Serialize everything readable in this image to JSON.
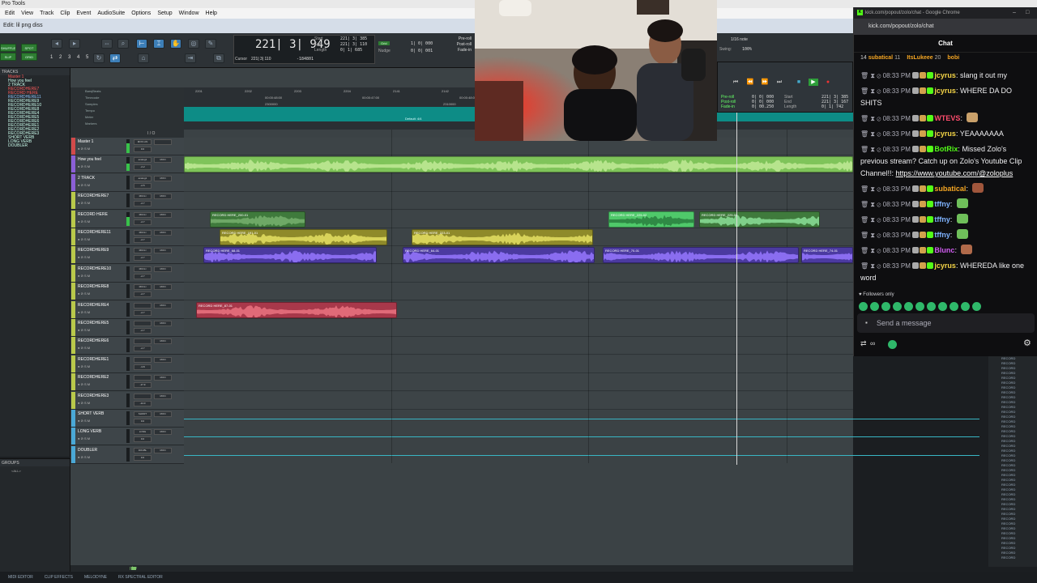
{
  "app": {
    "title": "Pro Tools",
    "menus": [
      "Edit",
      "View",
      "Track",
      "Clip",
      "Event",
      "AudioSuite",
      "Options",
      "Setup",
      "Window",
      "Help"
    ],
    "edit_window_title": "Edit: lil png diss"
  },
  "toolbar": {
    "shuffle": "SHUFFLE",
    "spot": "SPOT",
    "slip": "SLIP",
    "grid": "GRID",
    "zoom_presets": "1 2 3 4 5",
    "main_counter": "221| 3| 949",
    "start_label": "Start",
    "end_label": "End",
    "length_label": "Length",
    "start_value": "221| 3| 385",
    "end_value": "221| 3| 110",
    "length_value": "0| 1| 685",
    "cursor_label": "Cursor",
    "cursor_value": "221| 3| 110",
    "cursor_extra": "-184801",
    "grid_label": "Grid",
    "nudge_label": "Nudge",
    "grid_value": "1| 0| 000",
    "nudge_value": "0| 0| 001",
    "preroll": "Pre-roll",
    "postroll": "Post-roll",
    "fadein": "Fade-in"
  },
  "transport": {
    "note_value": "1/16 note",
    "swing_label": "Swing:",
    "swing_value": "100%",
    "pre_roll": "Pre-roll",
    "post_roll": "Post-roll",
    "fade_in": "Fade-in",
    "pre_val": "0| 0| 000",
    "post_val": "0| 0| 000",
    "fade_val": "0| 00.250",
    "start_lbl": "Start",
    "end_lbl": "End",
    "length_lbl": "Length",
    "start_val": "221| 3| 385",
    "end_val": "221| 3| 167",
    "length_val": "0| 1| 742"
  },
  "tracks_panel": {
    "title": "TRACKS",
    "items": [
      {
        "name": "Master 1",
        "color": "red"
      },
      {
        "name": "How you feel",
        "color": "normal"
      },
      {
        "name": "2 TRACK",
        "color": "normal"
      },
      {
        "name": "RECORDHERE7",
        "color": "red"
      },
      {
        "name": "RECORD HERE",
        "color": "red"
      },
      {
        "name": "RECORDHERE11",
        "color": "blue"
      },
      {
        "name": "RECORDHERE9",
        "color": "normal"
      },
      {
        "name": "RECORDHERE10",
        "color": "normal"
      },
      {
        "name": "RECORDHERE8",
        "color": "normal"
      },
      {
        "name": "RECORDHERE4",
        "color": "normal"
      },
      {
        "name": "RECORDHERE5",
        "color": "normal"
      },
      {
        "name": "RECORDHERE6",
        "color": "normal"
      },
      {
        "name": "RECORDHERE1",
        "color": "normal"
      },
      {
        "name": "RECORDHERE2",
        "color": "normal"
      },
      {
        "name": "RECORDHERE3",
        "color": "normal"
      },
      {
        "name": "SHORT VERB",
        "color": "normal"
      },
      {
        "name": "LONG VERB",
        "color": "normal"
      },
      {
        "name": "DOUBLER",
        "color": "normal"
      }
    ]
  },
  "groups_panel": {
    "title": "GROUPS",
    "items": [
      "<ALL>"
    ]
  },
  "rulers": {
    "names": [
      "Bars|Beats",
      "Timecode",
      "Samples",
      "Tempo",
      "Meter",
      "Markers"
    ],
    "bar_labels": [
      "2201",
      "2202",
      "2203",
      "2204",
      "2141",
      "2142"
    ],
    "timecode_labels": [
      "00:00:48:00",
      "00:00:47:00",
      "00:00:48:00"
    ],
    "sample_labels": [
      "2300000",
      "2310000"
    ],
    "default_tag": "Default: 4/4",
    "io_header": "I / O"
  },
  "tracks": [
    {
      "name": "Master 1",
      "io": "MON LIN",
      "vol": "0.0",
      "mon": "",
      "color": "#d24a4a",
      "meter": 70,
      "kind": "master"
    },
    {
      "name": "How you feel",
      "io": "analog1",
      "vol": "-2.2",
      "mon": "MON",
      "color": "#8b5fd6",
      "meter": 55,
      "kind": "audio"
    },
    {
      "name": "2 TRACK",
      "io": "analog1",
      "vol": "-2.5",
      "mon": "MON",
      "color": "#8b5fd6",
      "meter": 0,
      "kind": "audio"
    },
    {
      "name": "RECORDHERE7",
      "io": "MIC/LI",
      "vol": "-2.7",
      "mon": "MON",
      "color": "#b9c94a",
      "meter": 0,
      "kind": "audio"
    },
    {
      "name": "RECORD HERE",
      "io": "MIC/LI",
      "vol": "-2.7",
      "mon": "MON",
      "color": "#b9c94a",
      "meter": 60,
      "kind": "audio"
    },
    {
      "name": "RECORDHERE11",
      "io": "MIC/LI",
      "vol": "-2.7",
      "mon": "MON",
      "color": "#b9c94a",
      "meter": 0,
      "kind": "audio"
    },
    {
      "name": "RECORDHERE9",
      "io": "MIC/LI",
      "vol": "-2.7",
      "mon": "MON",
      "color": "#b9c94a",
      "meter": 0,
      "kind": "audio"
    },
    {
      "name": "RECORDHERE10",
      "io": "MIC/LI",
      "vol": "-2.7",
      "mon": "MON",
      "color": "#b9c94a",
      "meter": 0,
      "kind": "audio"
    },
    {
      "name": "RECORDHERE8",
      "io": "MIC/LI",
      "vol": "-2.7",
      "mon": "MON",
      "color": "#b9c94a",
      "meter": 0,
      "kind": "audio"
    },
    {
      "name": "RECORDHERE4",
      "io": "",
      "vol": "-2.7",
      "mon": "MON",
      "color": "#b9c94a",
      "meter": 0,
      "kind": "audio"
    },
    {
      "name": "RECORDHERE5",
      "io": "",
      "vol": "-2.7",
      "mon": "MON",
      "color": "#b9c94a",
      "meter": 0,
      "kind": "audio"
    },
    {
      "name": "RECORDHERE6",
      "io": "",
      "vol": "-2.7",
      "mon": "MON",
      "color": "#b9c94a",
      "meter": 0,
      "kind": "audio"
    },
    {
      "name": "RECORDHERE1",
      "io": "",
      "vol": "-3.8",
      "mon": "MON",
      "color": "#b9c94a",
      "meter": 0,
      "kind": "audio"
    },
    {
      "name": "RECORDHERE2",
      "io": "",
      "vol": "-17.9",
      "mon": "MON",
      "color": "#b9c94a",
      "meter": 0,
      "kind": "audio"
    },
    {
      "name": "RECORDHERE3",
      "io": "",
      "vol": "-14.0",
      "mon": "MON",
      "color": "#b9c94a",
      "meter": 0,
      "kind": "audio"
    },
    {
      "name": "SHORT VERB",
      "io": "SHORT",
      "vol": "0.0",
      "mon": "MON",
      "color": "#4aa8d6",
      "meter": 0,
      "kind": "aux"
    },
    {
      "name": "LONG VERB",
      "io": "LONG",
      "vol": "0.0",
      "mon": "MON",
      "color": "#4aa8d6",
      "meter": 0,
      "kind": "aux"
    },
    {
      "name": "DOUBLER",
      "io": "DOUBL",
      "vol": "0.0",
      "mon": "MON",
      "color": "#4aa8d6",
      "meter": 0,
      "kind": "aux"
    }
  ],
  "clips": [
    {
      "track": 1,
      "name": "",
      "start": 0,
      "end": 826,
      "color": "#7fc45a",
      "wave": "#b7e48d"
    },
    {
      "track": 4,
      "name": "RECORD HERE_200-01",
      "start": 32,
      "end": 150,
      "color": "#3f7a3c",
      "wave": "#6ea866"
    },
    {
      "track": 4,
      "name": "RECORD HERE_225-02",
      "start": 524,
      "end": 630,
      "color": "#4fc96a",
      "wave": "#2f8a45"
    },
    {
      "track": 4,
      "name": "RECORD HERE_225-03",
      "start": 636,
      "end": 785,
      "color": "#3f7a3c",
      "wave": "#7fd08a"
    },
    {
      "track": 5,
      "name": "RECORD HERE_191-01",
      "start": 44,
      "end": 251,
      "color": "#8f8a2a",
      "wave": "#d8d35a"
    },
    {
      "track": 5,
      "name": "RECORD HERE_223-01",
      "start": 281,
      "end": 505,
      "color": "#8f8a2a",
      "wave": "#d8d35a"
    },
    {
      "track": 6,
      "name": "RECORD HERE_68-01",
      "start": 24,
      "end": 238,
      "color": "#4b3aa0",
      "wave": "#8a6df0"
    },
    {
      "track": 6,
      "name": "RECORD HERE_64-01",
      "start": 270,
      "end": 507,
      "color": "#4b3aa0",
      "wave": "#8a6df0"
    },
    {
      "track": 6,
      "name": "RECORD HERE_70-01",
      "start": 517,
      "end": 759,
      "color": "#4b3aa0",
      "wave": "#8a6df0"
    },
    {
      "track": 6,
      "name": "RECORD HERE_74-01",
      "start": 762,
      "end": 826,
      "color": "#4b3aa0",
      "wave": "#8a6df0"
    },
    {
      "track": 9,
      "name": "RECORD HERE_87-01",
      "start": 15,
      "end": 263,
      "color": "#a8384a",
      "wave": "#e06a78"
    }
  ],
  "bottom_bar": {
    "tabs": [
      "MIDI EDITOR",
      "CLIP EFFECTS",
      "MELODYNE",
      "RX SPECTRAL EDITOR"
    ],
    "scroll_label": "play"
  },
  "right_list": {
    "items": [
      "RECORD",
      "RECORD",
      "RECORD",
      "RECORD",
      "RECORD",
      "RECORD",
      "RECORD",
      "RECORD",
      "RECORD",
      "RECORD",
      "RECORD",
      "RECORD",
      "RECORD",
      "RECORD",
      "RECORD",
      "RECORD",
      "RECORD",
      "RECORD",
      "RECORD",
      "RECORD",
      "RECORD",
      "RECORD",
      "RECORD",
      "RECORD",
      "RECORD",
      "RECORD",
      "RECORD",
      "RECORD",
      "RECORD",
      "RECORD",
      "RECORD",
      "RECORD",
      "RECORD",
      "RECORD",
      "RECORD",
      "RECORD",
      "RECORD",
      "RECORD",
      "RECORD",
      "RECORD",
      "RECORD",
      "RECORD"
    ]
  },
  "chat": {
    "window_title": "kick.com/popout/zolo/chat - Google Chrome",
    "url": "kick.com/popout/zolo/chat",
    "header": "Chat",
    "pinned": [
      {
        "rank": "14",
        "user": "subatical",
        "count": "11"
      },
      {
        "rank": "",
        "user": "ItsLukeee",
        "count": "20"
      },
      {
        "rank": "",
        "user": "bobi",
        "count": ""
      }
    ],
    "messages": [
      {
        "time": "08:33 PM",
        "user": "jcyrus",
        "color": "#f5d547",
        "text": "slang it out my",
        "emote": ""
      },
      {
        "time": "08:33 PM",
        "user": "jcyrus",
        "color": "#f5d547",
        "text": "WHERE DA DO SHITS",
        "emote": ""
      },
      {
        "time": "08:33 PM",
        "user": "WTEVS",
        "color": "#ff4d6d",
        "text": "",
        "emote": "#c9a06a"
      },
      {
        "time": "08:33 PM",
        "user": "jcyrus",
        "color": "#f5d547",
        "text": "YEAAAAAAA",
        "emote": ""
      },
      {
        "time": "08:33 PM",
        "user": "BotRix",
        "color": "#53fc18",
        "text": "Missed Zolo's previous stream? Catch up on Zolo's Youtube Clip Channel!!:",
        "link": "https://www.youtube.com/@zoloplus",
        "emote": ""
      },
      {
        "time": "08:33 PM",
        "user": "subatical",
        "color": "#f5a623",
        "text": "",
        "emote": "#a0563c"
      },
      {
        "time": "08:33 PM",
        "user": "tffny",
        "color": "#7fb3ff",
        "text": "",
        "emote": "#6fbf5a"
      },
      {
        "time": "08:33 PM",
        "user": "tffny",
        "color": "#7fb3ff",
        "text": "",
        "emote": "#6fbf5a"
      },
      {
        "time": "08:33 PM",
        "user": "tffny",
        "color": "#7fb3ff",
        "text": "",
        "emote": "#6fbf5a"
      },
      {
        "time": "08:33 PM",
        "user": "Blunc",
        "color": "#d05cf0",
        "text": "",
        "emote": "#b06a4a"
      },
      {
        "time": "08:33 PM",
        "user": "jcyrus",
        "color": "#f5d547",
        "text": "WHEREDA like one word",
        "emote": ""
      }
    ],
    "followers_only": "Followers only",
    "send_placeholder": "Send a message",
    "timer": "∞",
    "colors": {
      "background": "#0e0e10",
      "accent": "#53fc18"
    }
  }
}
